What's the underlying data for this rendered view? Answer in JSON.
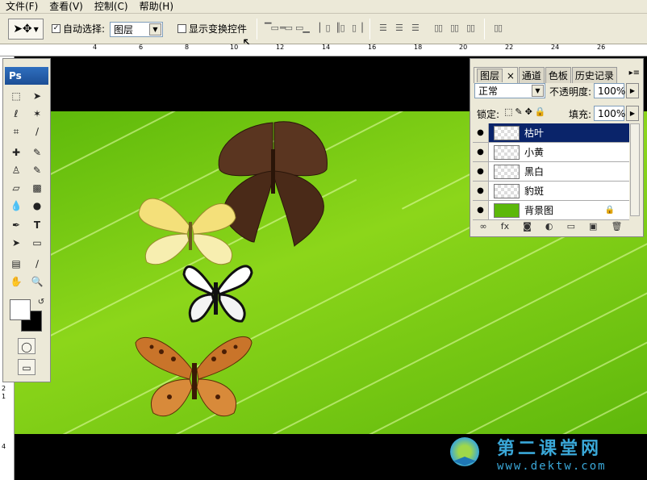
{
  "menu": [
    "文件(F)",
    "查看(V)",
    "控制(C)",
    "帮助(H)"
  ],
  "options": {
    "auto_select_label": "自动选择:",
    "auto_select_value": "图层",
    "show_transform_label": "显示变换控件"
  },
  "ruler": {
    "h_labels": [
      "4",
      "6",
      "8",
      "10",
      "12",
      "14",
      "16",
      "18",
      "20",
      "22",
      "24",
      "26"
    ],
    "v_labels": [
      "2",
      "1",
      "4"
    ]
  },
  "toolbox": {
    "logo": "Ps"
  },
  "layers_panel": {
    "tabs": [
      "图层",
      "通道",
      "色板",
      "历史记录"
    ],
    "blend_mode": "正常",
    "opacity_label": "不透明度:",
    "opacity_value": "100%",
    "lock_label": "锁定:",
    "fill_label": "填充:",
    "fill_value": "100%",
    "layers": [
      {
        "name": "枯叶",
        "selected": true
      },
      {
        "name": "小黄",
        "selected": false
      },
      {
        "name": "黑白",
        "selected": false
      },
      {
        "name": "豹斑",
        "selected": false
      },
      {
        "name": "背景图",
        "selected": false,
        "locked": true
      }
    ],
    "bottom_icons": [
      "link-icon",
      "fx-icon",
      "mask-icon",
      "adjustment-icon",
      "folder-icon",
      "new-layer-icon",
      "trash-icon"
    ]
  },
  "watermark": {
    "title": "第二课堂网",
    "url": "www.dektw.com"
  },
  "colors": {
    "selection": "#0a246a",
    "ps_blue": "#2f6fbf",
    "leaf_green": "#6cc010",
    "watermark": "#3aa8d8"
  }
}
